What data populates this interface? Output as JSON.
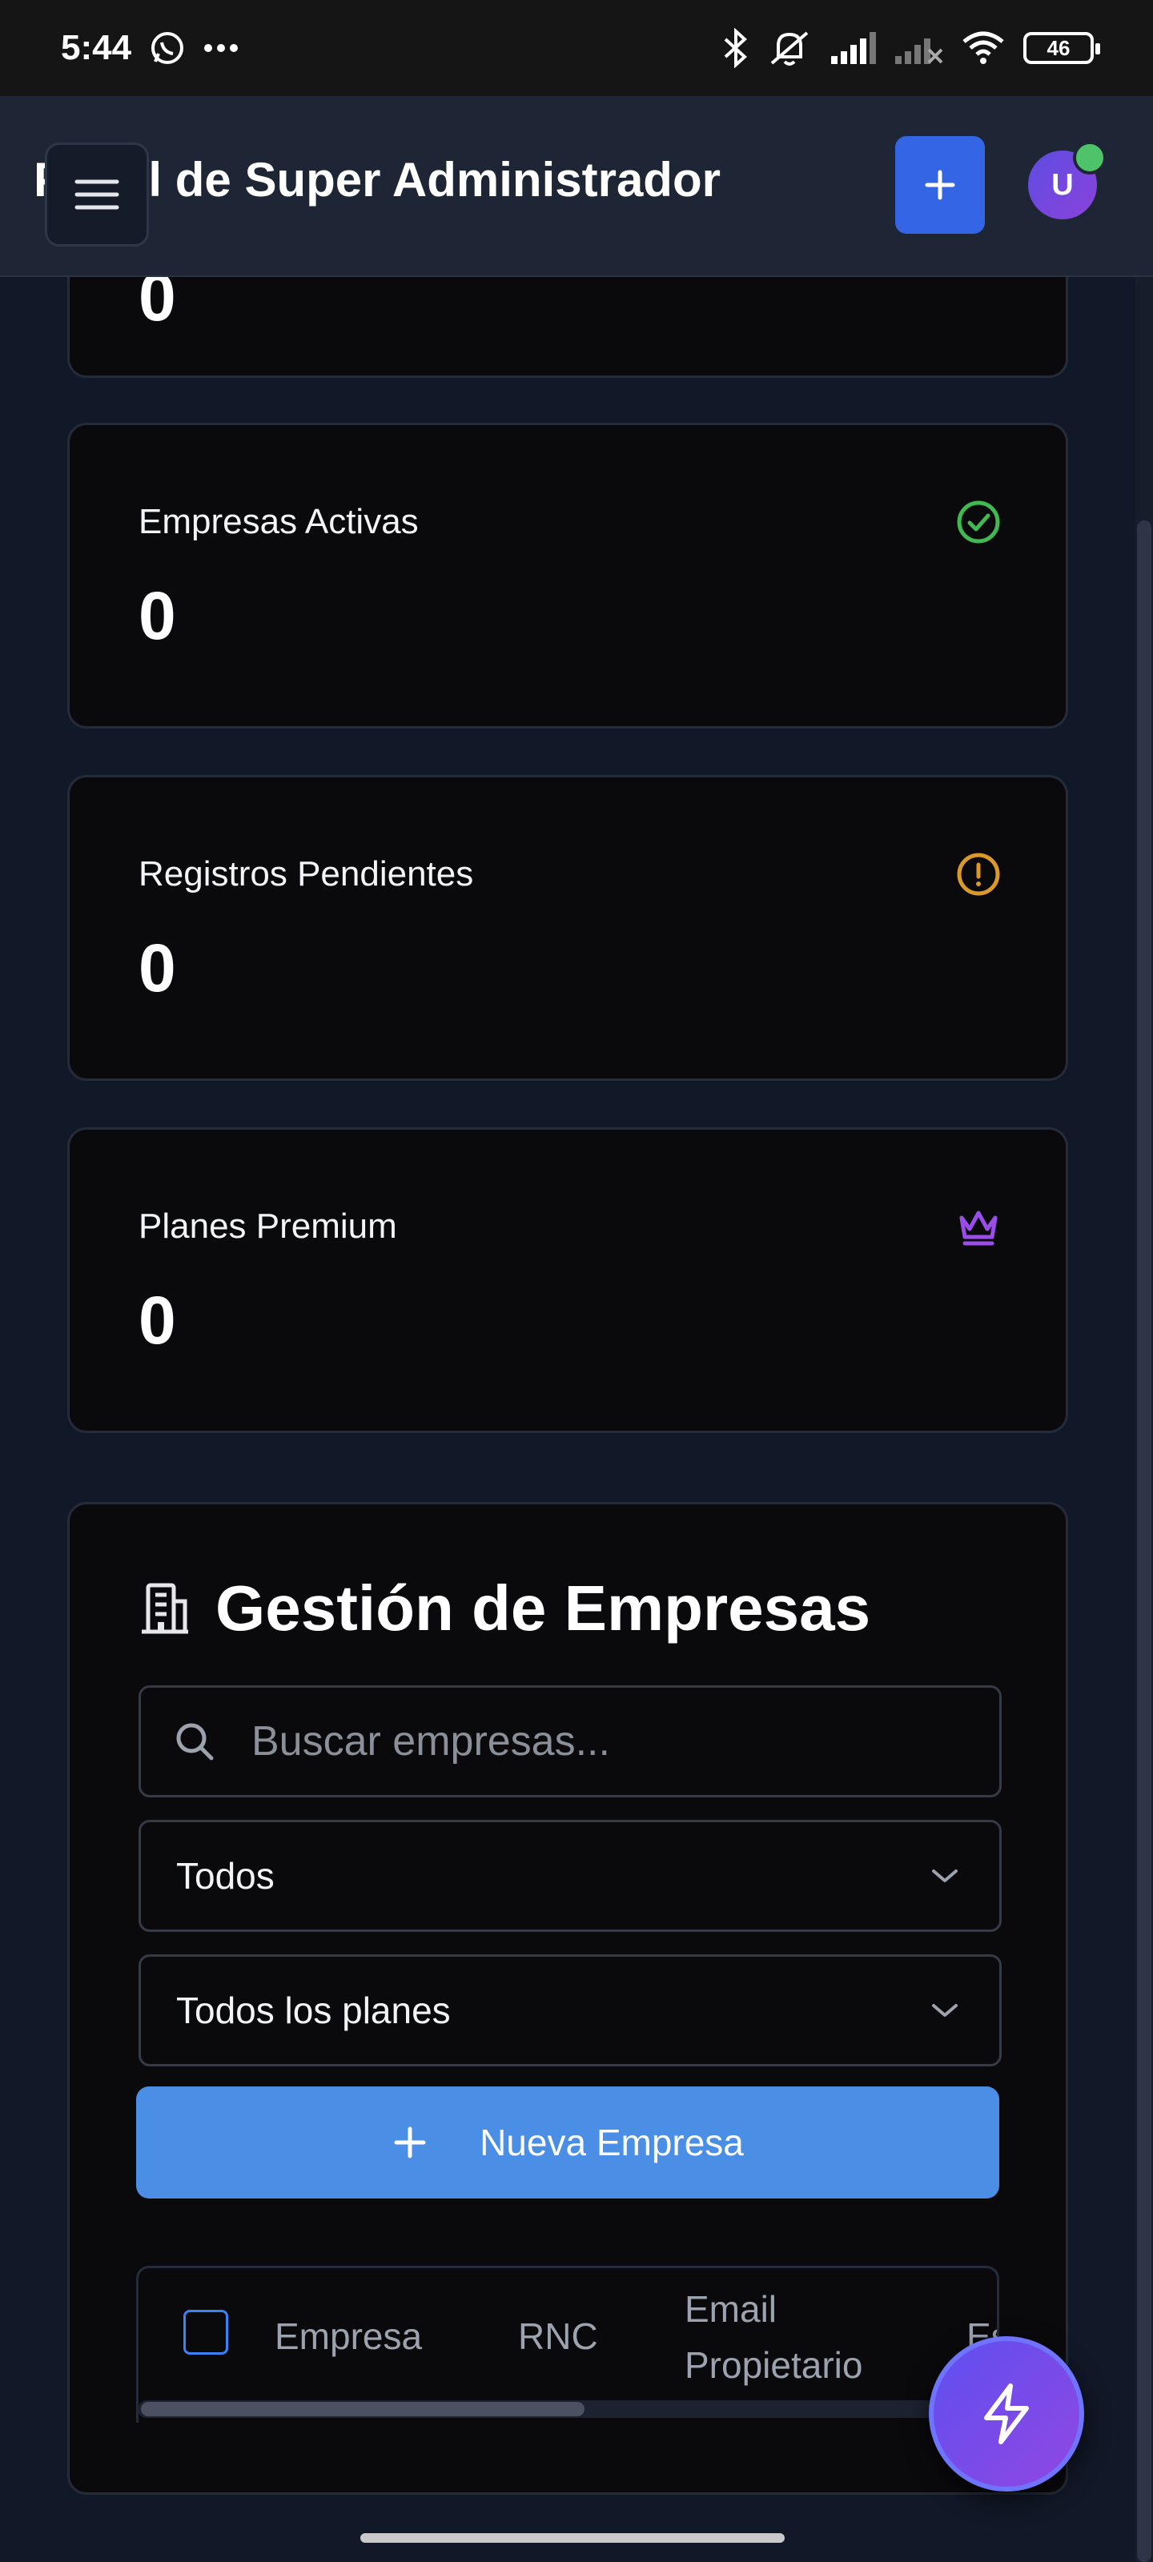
{
  "status_bar": {
    "time": "5:44",
    "battery": "46",
    "icons": [
      "whatsapp-icon",
      "more-icon",
      "bluetooth-icon",
      "mute-icon",
      "signal-icon",
      "signal-no-service-icon",
      "wifi-icon",
      "battery-icon"
    ]
  },
  "header": {
    "title": "Panel de Super Administrador",
    "add_label": "+",
    "avatar_initial": "U",
    "colors": {
      "background": "#1e2635",
      "add_button": "#3465e4",
      "online": "#4ec36a"
    }
  },
  "stats": [
    {
      "label": "Empresas Activas",
      "value": "0",
      "icon": "check-circle-icon",
      "color": "#3fb950"
    },
    {
      "label": "Registros Pendientes",
      "value": "0",
      "icon": "alert-circle-icon",
      "color": "#d99a2b"
    },
    {
      "label": "Planes Premium",
      "value": "0",
      "icon": "crown-icon",
      "color": "#9b4dea"
    }
  ],
  "partial_card_value": "0",
  "management": {
    "title": "Gestión de Empresas",
    "icon": "building-icon",
    "search_placeholder": "Buscar empresas...",
    "status_filter": "Todos",
    "plan_filter": "Todos los planes",
    "new_button": "Nueva Empresa",
    "table_headers": [
      "Empresa",
      "RNC",
      "Email Propietario",
      "Es"
    ],
    "accent": "#4a8ee6"
  },
  "fab_icon": "lightning-icon"
}
